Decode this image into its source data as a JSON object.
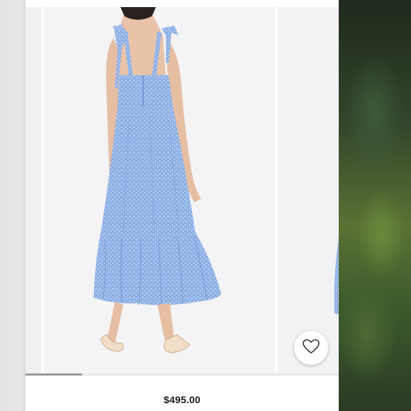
{
  "listing": {
    "price": "$495.00"
  },
  "gallery": {
    "slide_count_visible": 3,
    "scroll_progress": 0.18,
    "dress_color": "#8fb1e6",
    "dress_shadow_color": "#6f93cf",
    "background_color": "#f4f4f6"
  },
  "icons": {
    "like": "heart-outline-icon"
  }
}
